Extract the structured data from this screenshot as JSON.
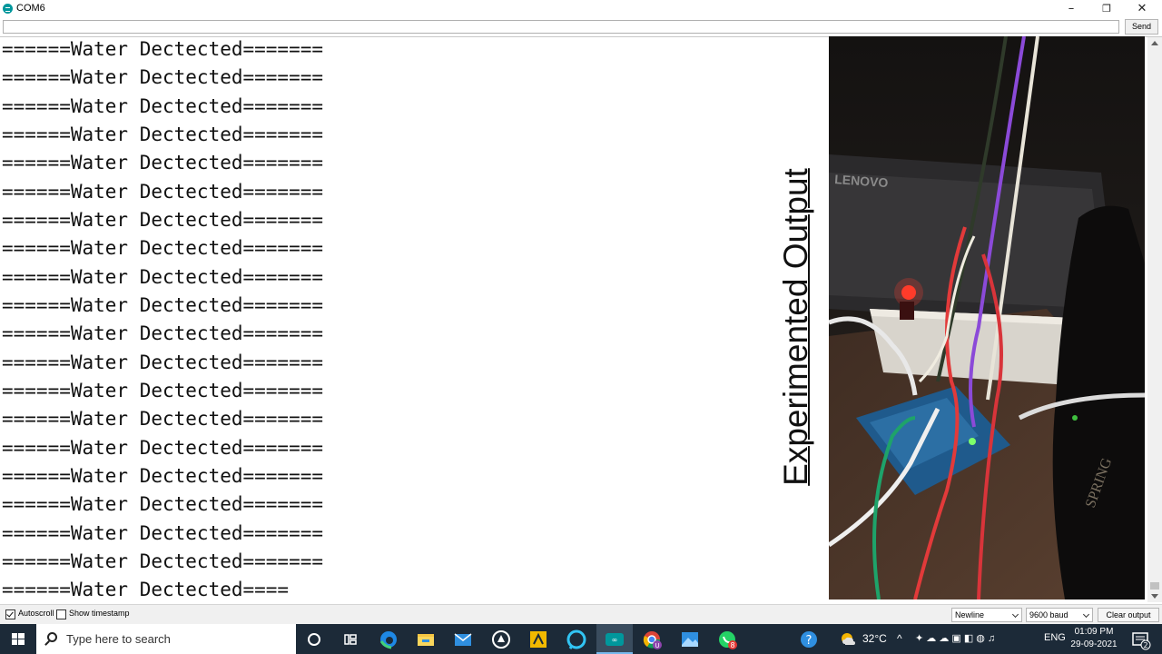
{
  "window": {
    "title": "COM6",
    "minimize_glyph": "–",
    "maximize_glyph": "❐",
    "close_glyph": "✕"
  },
  "send_row": {
    "input_value": "",
    "send_label": "Send"
  },
  "output": {
    "lines": [
      "======Water Dectected=======",
      "======Water Dectected=======",
      "======Water Dectected=======",
      "======Water Dectected=======",
      "======Water Dectected=======",
      "======Water Dectected=======",
      "======Water Dectected=======",
      "======Water Dectected=======",
      "======Water Dectected=======",
      "======Water Dectected=======",
      "======Water Dectected=======",
      "======Water Dectected=======",
      "======Water Dectected=======",
      "======Water Dectected=======",
      "======Water Dectected=======",
      "======Water Dectected=======",
      "======Water Dectected=======",
      "======Water Dectected=======",
      "======Water Dectected=======",
      "======Water Dectected===="
    ]
  },
  "overlay": {
    "label": "Experimented Output",
    "photo_brand_text": "LENOVO",
    "photo_side_text": "SPRING"
  },
  "options": {
    "autoscroll_label": "Autoscroll",
    "autoscroll_checked": true,
    "timestamp_label": "Show timestamp",
    "timestamp_checked": false,
    "line_ending": "Newline",
    "baud_rate": "9600 baud",
    "clear_label": "Clear output"
  },
  "taskbar": {
    "search_placeholder": "Type here to search",
    "weather_temp": "32°C",
    "language": "ENG",
    "time": "01:09 PM",
    "date": "29-09-2021",
    "notification_count": "2",
    "whatsapp_badge": "8",
    "chrome_badge": "U",
    "icons": [
      "start-icon",
      "cortana-icon",
      "task-view-icon",
      "edge-icon",
      "file-explorer-icon",
      "mail-icon",
      "vpn-icon",
      "sticky-app-icon",
      "alexa-icon",
      "arduino-icon",
      "chrome-icon",
      "photos-icon",
      "whatsapp-icon",
      "help-icon"
    ]
  },
  "colors": {
    "arduino_teal": "#00979c",
    "taskbar_bg": "#1c2a38",
    "active_task_indicator": "#76b9ed"
  }
}
